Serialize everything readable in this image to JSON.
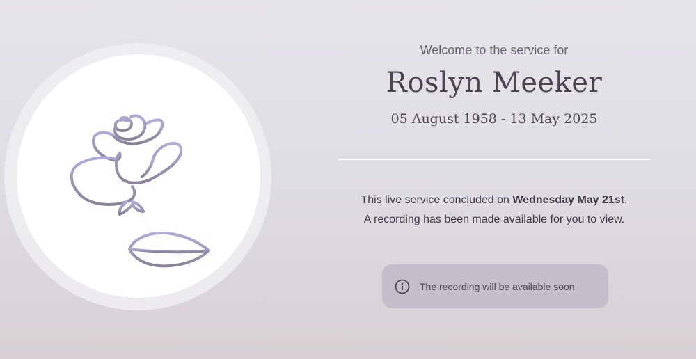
{
  "service": {
    "welcome": "Welcome to the service for",
    "name": "Roslyn Meeker",
    "dates": "05 August 1958 - 13 May 2025"
  },
  "message": {
    "line1_prefix": "This live service concluded on ",
    "line1_date": "Wednesday May 21st",
    "line1_suffix": ".",
    "line2": "A recording has been made available for you to view."
  },
  "notice": {
    "icon": "info-icon",
    "text": "The recording will be available soon"
  },
  "colors": {
    "background_top": "#e6e5ea",
    "background_bottom": "#d8d0d5",
    "rose_line_top": "#a9a6d2",
    "rose_line_bottom": "#8a8098",
    "notice_background": "#c6bfcb",
    "text_dark": "#4a4550"
  },
  "photo": {
    "icon": "rose-line-art-icon"
  }
}
